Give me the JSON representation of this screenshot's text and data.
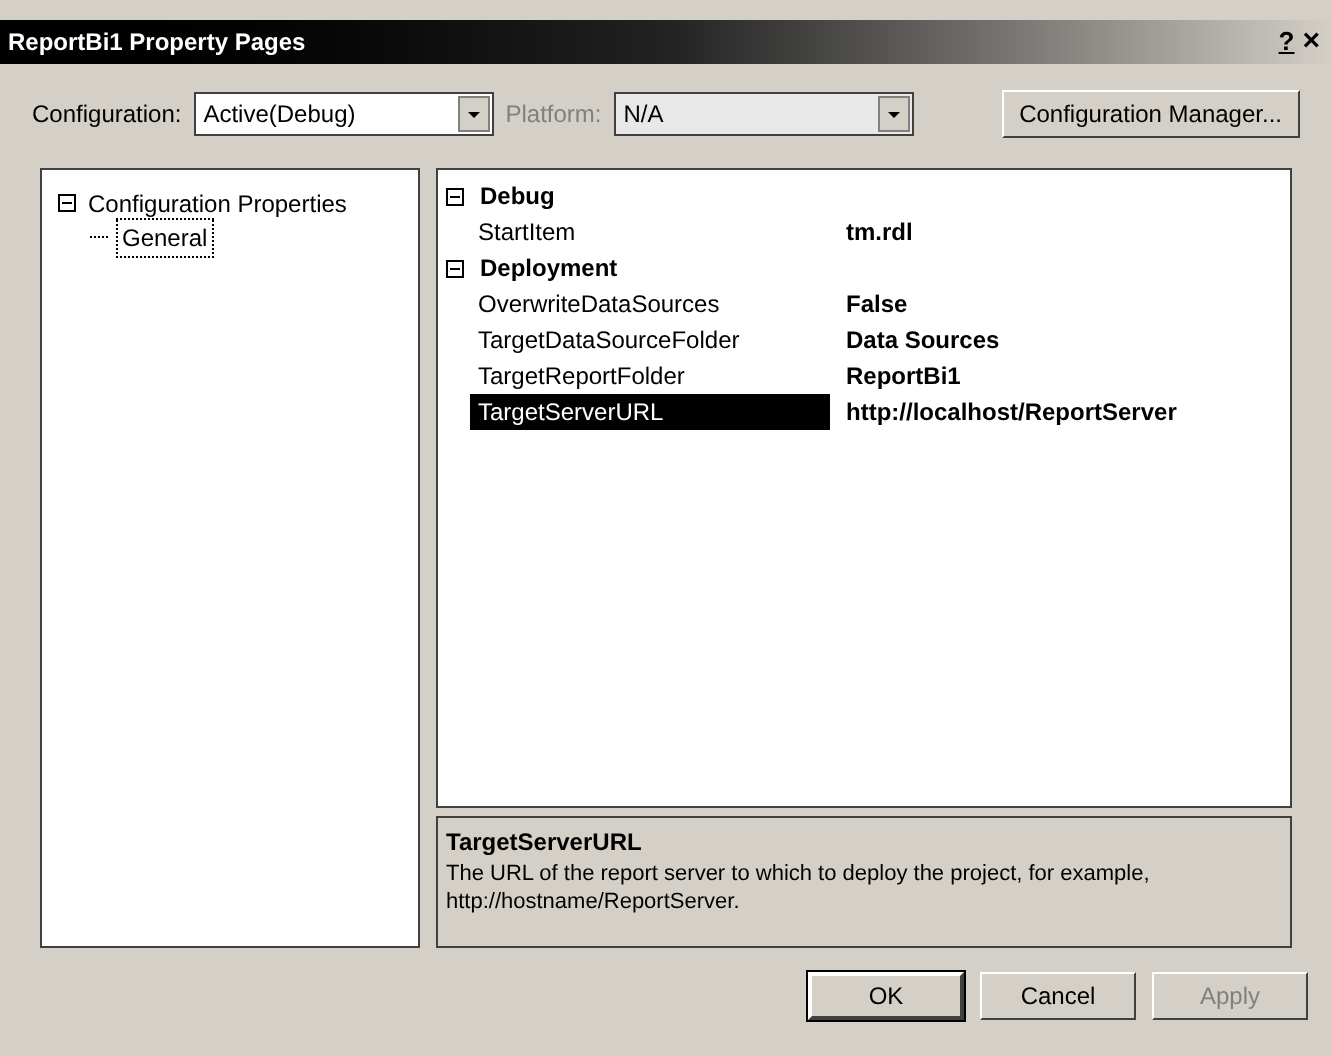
{
  "window": {
    "title": "ReportBi1 Property Pages",
    "help": "?",
    "close": "×"
  },
  "configuration": {
    "label": "Configuration:",
    "value": "Active(Debug)"
  },
  "platform": {
    "label": "Platform:",
    "value": "N/A",
    "disabled": true
  },
  "config_manager_button": "Configuration Manager...",
  "tree": [
    {
      "label": "Configuration Properties",
      "expanded": true,
      "children": [
        {
          "label": "General",
          "selected": true
        }
      ]
    }
  ],
  "grid": [
    {
      "category": "Debug",
      "expanded": true,
      "rows": [
        {
          "name": "StartItem",
          "value": "tm.rdl",
          "selected": false
        }
      ]
    },
    {
      "category": "Deployment",
      "expanded": true,
      "rows": [
        {
          "name": "OverwriteDataSources",
          "value": "False",
          "selected": false
        },
        {
          "name": "TargetDataSourceFolder",
          "value": "Data Sources",
          "selected": false
        },
        {
          "name": "TargetReportFolder",
          "value": "ReportBi1",
          "selected": false
        },
        {
          "name": "TargetServerURL",
          "value": "http://localhost/ReportServer",
          "selected": true
        }
      ]
    }
  ],
  "description": {
    "title": "TargetServerURL",
    "text": "The URL of the report server to which to deploy the project, for example, http://hostname/ReportServer."
  },
  "buttons": [
    {
      "label": "OK",
      "default": true,
      "disabled": false
    },
    {
      "label": "Cancel",
      "default": false,
      "disabled": false
    },
    {
      "label": "Apply",
      "default": false,
      "disabled": true
    }
  ]
}
